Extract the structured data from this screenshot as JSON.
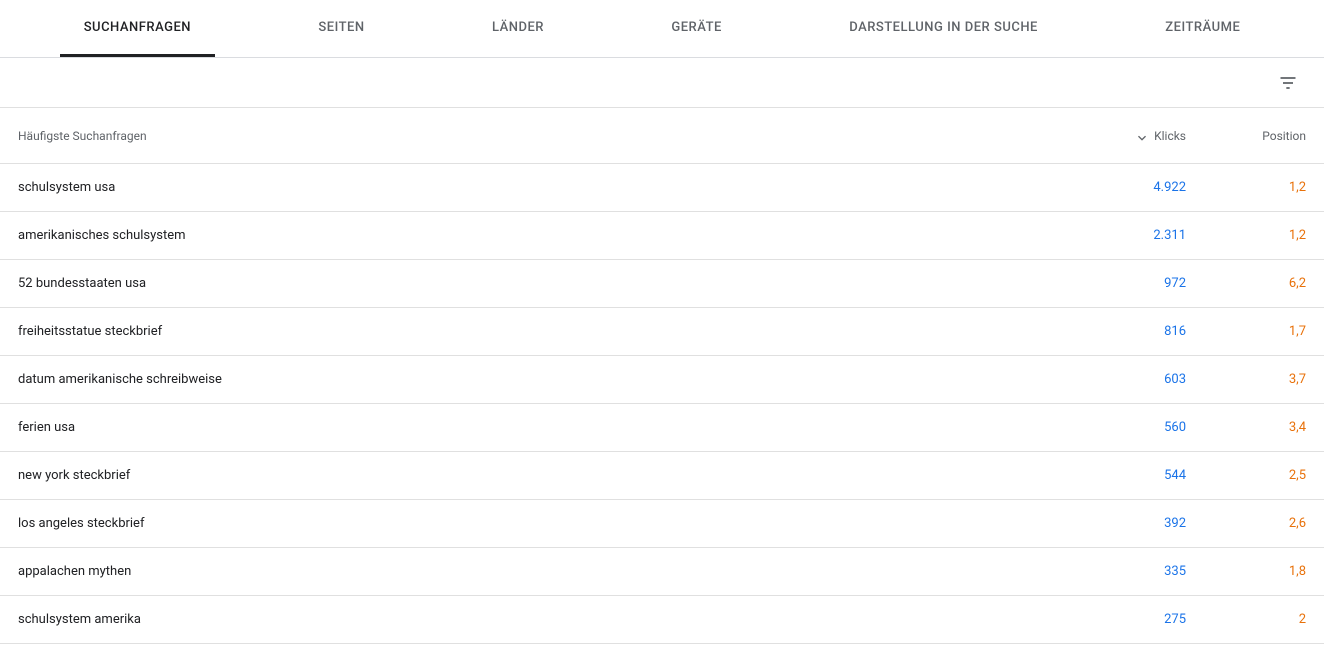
{
  "tabs": [
    {
      "label": "SUCHANFRAGEN",
      "active": true
    },
    {
      "label": "SEITEN",
      "active": false
    },
    {
      "label": "LÄNDER",
      "active": false
    },
    {
      "label": "GERÄTE",
      "active": false
    },
    {
      "label": "DARSTELLUNG IN DER SUCHE",
      "active": false
    },
    {
      "label": "ZEITRÄUME",
      "active": false
    }
  ],
  "table": {
    "headers": {
      "query": "Häufigste Suchanfragen",
      "clicks": "Klicks",
      "position": "Position"
    },
    "rows": [
      {
        "query": "schulsystem usa",
        "clicks": "4.922",
        "position": "1,2"
      },
      {
        "query": "amerikanisches schulsystem",
        "clicks": "2.311",
        "position": "1,2"
      },
      {
        "query": "52 bundesstaaten usa",
        "clicks": "972",
        "position": "6,2"
      },
      {
        "query": "freiheitsstatue steckbrief",
        "clicks": "816",
        "position": "1,7"
      },
      {
        "query": "datum amerikanische schreibweise",
        "clicks": "603",
        "position": "3,7"
      },
      {
        "query": "ferien usa",
        "clicks": "560",
        "position": "3,4"
      },
      {
        "query": "new york steckbrief",
        "clicks": "544",
        "position": "2,5"
      },
      {
        "query": "los angeles steckbrief",
        "clicks": "392",
        "position": "2,6"
      },
      {
        "query": "appalachen mythen",
        "clicks": "335",
        "position": "1,8"
      },
      {
        "query": "schulsystem amerika",
        "clicks": "275",
        "position": "2"
      }
    ]
  }
}
